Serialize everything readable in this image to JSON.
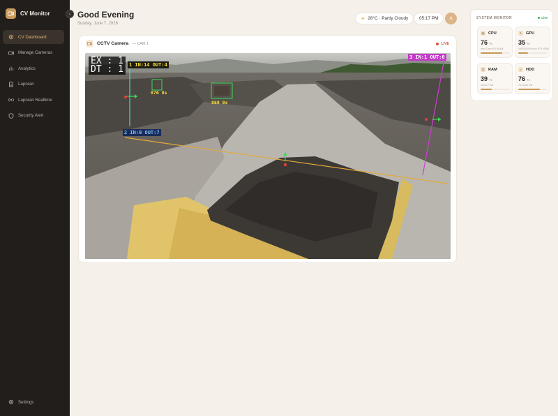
{
  "app": {
    "name": "CV Monitor",
    "logo": "camera-icon"
  },
  "sidebar": {
    "items": [
      {
        "label": "CV Dashboard",
        "icon": "gear-icon",
        "active": true
      },
      {
        "label": "Manage Cameras",
        "icon": "video-icon",
        "active": false
      },
      {
        "label": "Analytics",
        "icon": "bar-chart-icon",
        "active": false
      },
      {
        "label": "Laporan",
        "icon": "document-icon",
        "active": false
      },
      {
        "label": "Laporan Realtime",
        "icon": "realtime-icon",
        "active": false
      },
      {
        "label": "Security Alert",
        "icon": "shield-icon",
        "active": false
      }
    ],
    "settings_label": "Settings",
    "collapse_icon": "chevron-left-icon"
  },
  "header": {
    "greeting": "Good Evening",
    "date": "Sunday, June 7, 2026",
    "weather": "28°C · Partly Cloudy",
    "time": "05:17 PM",
    "avatar_initial": "A"
  },
  "camera": {
    "title": "CCTV Camera",
    "subtitle": "— CAM 1",
    "live_label": "LIVE",
    "overlay": {
      "counter_ex": "EX : 1",
      "counter_dt": "DT : 1",
      "line1": "1 IN:14 OUT:4",
      "line2": "2 IN:0 OUT:7",
      "line3": "3 IN:1 OUT:0",
      "det1": "870 8s",
      "det2": "868 8s"
    }
  },
  "system_monitor": {
    "title": "SYSTEM MONITOR",
    "live_label": "Live",
    "metrics": [
      {
        "label": "CPU",
        "value": "76",
        "unit": "%",
        "detail": "Intel Core i9-14900K",
        "percent": 76
      },
      {
        "label": "GPU",
        "value": "35",
        "unit": "%",
        "detail": "NVIDIA GeForce RTX 4090",
        "percent": 35
      },
      {
        "label": "RAM",
        "value": "39",
        "unit": "%",
        "detail": "12/31.7 GB",
        "percent": 39
      },
      {
        "label": "HDD",
        "value": "76",
        "unit": "%",
        "detail": "76.1/100 GB",
        "percent": 76
      }
    ]
  },
  "colors": {
    "accent": "#c89a5c",
    "sidebar_bg": "#221e1b",
    "live_red": "#d9533a",
    "live_green": "#3fb160"
  }
}
